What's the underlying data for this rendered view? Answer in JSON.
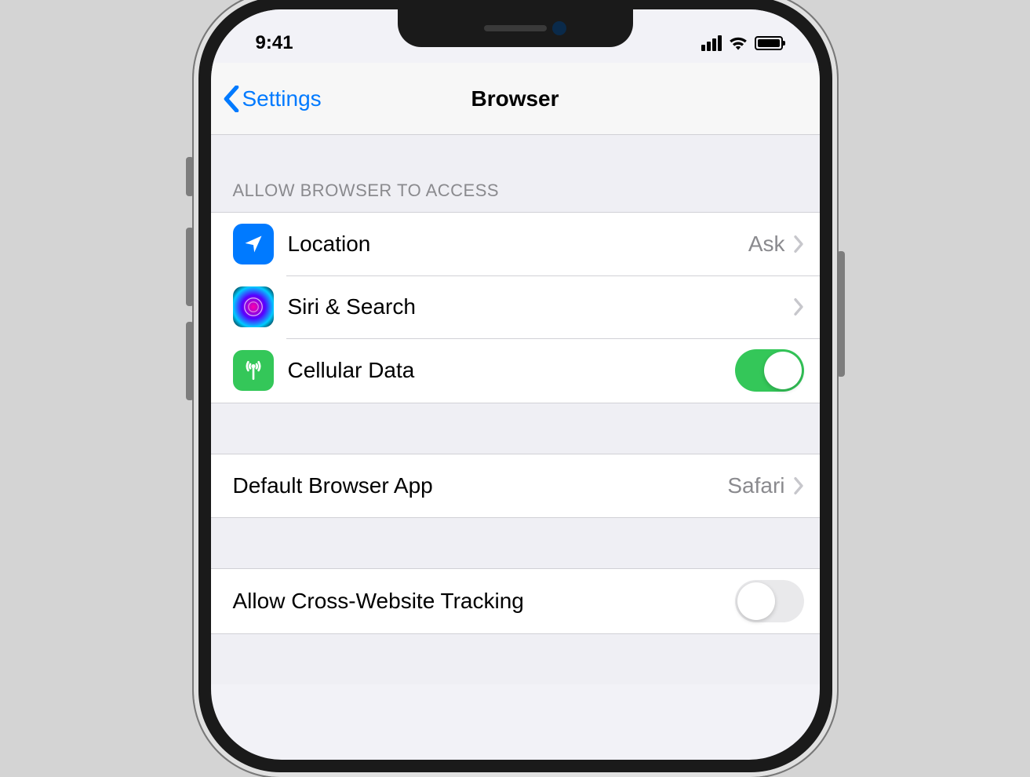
{
  "status_bar": {
    "time": "9:41"
  },
  "nav": {
    "back_label": "Settings",
    "title": "Browser"
  },
  "sections": {
    "access_header": "ALLOW BROWSER TO ACCESS",
    "location": {
      "label": "Location",
      "value": "Ask"
    },
    "siri": {
      "label": "Siri & Search"
    },
    "cellular": {
      "label": "Cellular Data",
      "enabled": true
    },
    "default_browser": {
      "label": "Default Browser App",
      "value": "Safari"
    },
    "cross_site": {
      "label": "Allow Cross-Website Tracking",
      "enabled": false
    }
  },
  "colors": {
    "tint": "#007aff",
    "toggle_on": "#34c759",
    "cellular_green": "#34c759"
  }
}
